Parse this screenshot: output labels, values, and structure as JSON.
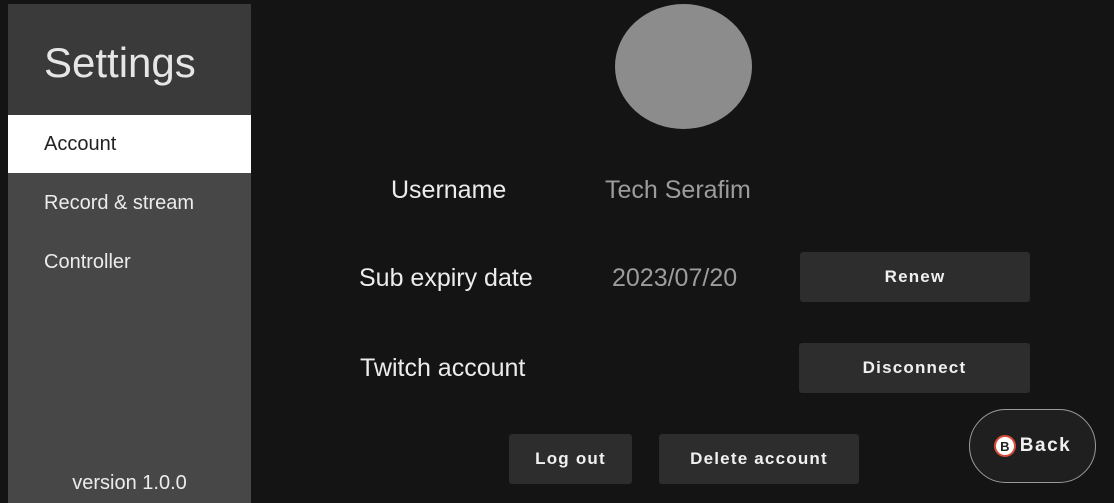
{
  "sidebar": {
    "title": "Settings",
    "items": [
      {
        "label": "Account",
        "active": true
      },
      {
        "label": "Record & stream",
        "active": false
      },
      {
        "label": "Controller",
        "active": false
      }
    ],
    "version": "version 1.0.0"
  },
  "account": {
    "username_label": "Username",
    "username_value": "Tech Serafim",
    "expiry_label": "Sub expiry date",
    "expiry_value": "2023/07/20",
    "renew_label": "Renew",
    "twitch_label": "Twitch account",
    "disconnect_label": "Disconnect",
    "logout_label": "Log out",
    "delete_label": "Delete account"
  },
  "back": {
    "icon_letter": "B",
    "label": "Back"
  },
  "colors": {
    "background": "#141414",
    "sidebar": "#474747",
    "sidebar_header": "#3a3a3a",
    "active_item": "#ffffff",
    "button": "#2d2d2d",
    "avatar": "#8c8c8c",
    "b_icon_ring": "#d64b3a"
  },
  "icons": {
    "avatar": "avatar-placeholder-circle",
    "back_button_glyph": "b-button-icon"
  }
}
